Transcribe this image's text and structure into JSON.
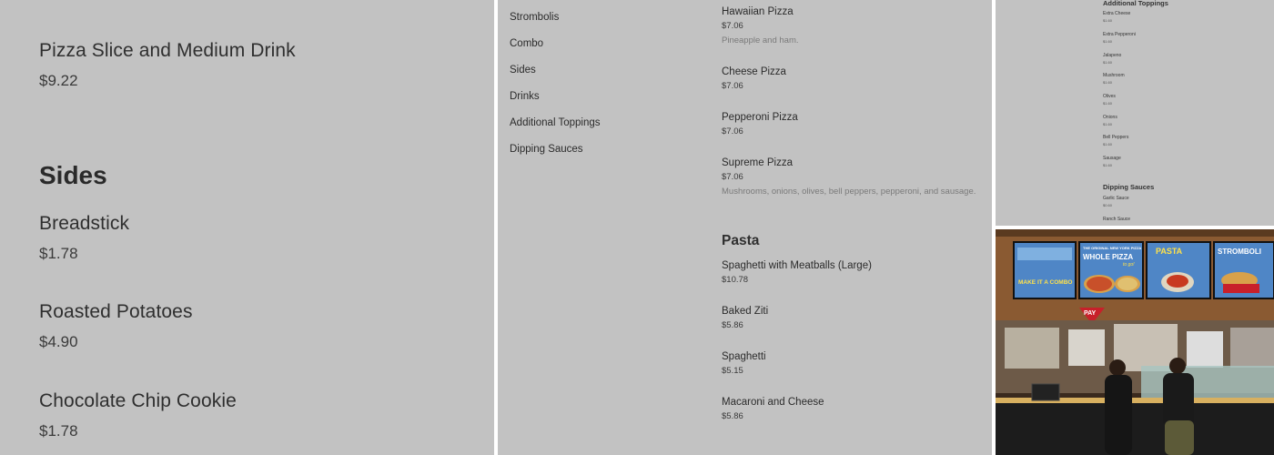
{
  "zoom_panel": {
    "cut_off_text": "",
    "items_top": [
      {
        "name": "Pizza Slice and Medium Drink",
        "price": "$9.22"
      }
    ],
    "section_heading": "Sides",
    "items": [
      {
        "name": "Breadstick",
        "price": "$1.78"
      },
      {
        "name": "Roasted Potatoes",
        "price": "$4.90"
      },
      {
        "name": "Chocolate Chip Cookie",
        "price": "$1.78"
      }
    ]
  },
  "menu_page": {
    "nav": [
      "Strombolis",
      "Combo",
      "Sides",
      "Drinks",
      "Additional Toppings",
      "Dipping Sauces"
    ],
    "pizza_items": [
      {
        "name": "Hawaiian Pizza",
        "price": "$7.06",
        "description": "Pineapple and ham."
      },
      {
        "name": "Cheese Pizza",
        "price": "$7.06",
        "description": ""
      },
      {
        "name": "Pepperoni Pizza",
        "price": "$7.06",
        "description": ""
      },
      {
        "name": "Supreme Pizza",
        "price": "$7.06",
        "description": "Mushrooms, onions, olives, bell peppers, pepperoni, and sausage."
      }
    ],
    "pasta_heading": "Pasta",
    "pasta_items": [
      {
        "name": "Spaghetti with Meatballs (Large)",
        "price": "$10.78"
      },
      {
        "name": "Baked Ziti",
        "price": "$5.86"
      },
      {
        "name": "Spaghetti",
        "price": "$5.15"
      },
      {
        "name": "Macaroni and Cheese",
        "price": "$5.86"
      }
    ]
  },
  "tiny_menu": {
    "toppings_heading": "Additional Toppings",
    "toppings": [
      {
        "name": "Extra Cheese",
        "price": "$1.60"
      },
      {
        "name": "Extra Pepperoni",
        "price": "$1.60"
      },
      {
        "name": "Jalapeno",
        "price": "$1.60"
      },
      {
        "name": "Mushroom",
        "price": "$1.60"
      },
      {
        "name": "Olives",
        "price": "$1.60"
      },
      {
        "name": "Onions",
        "price": "$1.60"
      },
      {
        "name": "Bell Peppers",
        "price": "$1.60"
      },
      {
        "name": "Sausage",
        "price": "$1.60"
      }
    ],
    "sauces_heading": "Dipping Sauces",
    "sauces": [
      {
        "name": "Garlic Sauce",
        "price": "$0.60"
      },
      {
        "name": "Ranch Sauce",
        "price": ""
      }
    ]
  },
  "photo": {
    "board_1_title": "MAKE IT A COMBO",
    "board_2_title": "WHOLE PIZZA",
    "board_2_sub": "to go!",
    "board_2_banner": "THE ORIGINAL NEW YORK PIZZA",
    "board_3_title": "PASTA",
    "board_4_title": "STROMBOLI",
    "pay_sign": "PAY",
    "colors": {
      "wood": "#8a5a32",
      "board_blue": "#4f86c6",
      "board_red": "#c8202a",
      "counter": "#1c1c1c"
    }
  }
}
